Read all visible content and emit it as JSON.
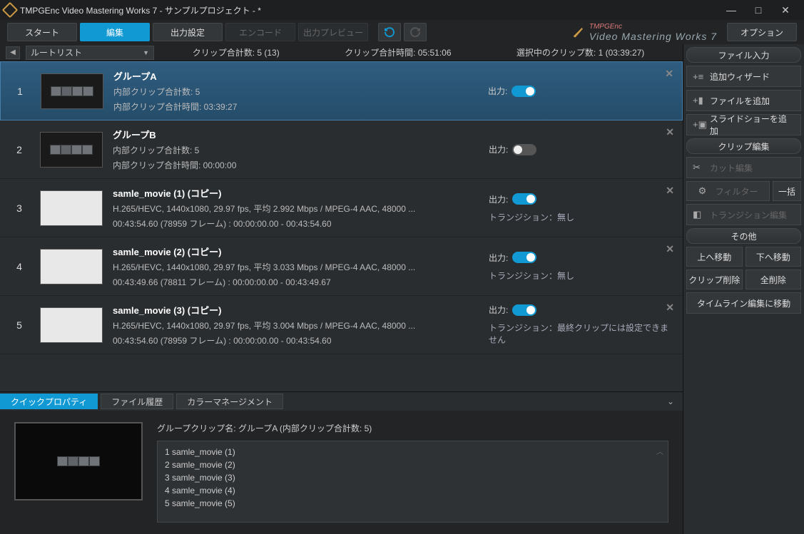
{
  "window": {
    "title": "TMPGEnc Video Mastering Works 7 - サンプルプロジェクト - *"
  },
  "toolbar": {
    "start": "スタート",
    "edit": "編集",
    "output": "出力設定",
    "encode": "エンコード",
    "preview": "出力プレビュー",
    "options": "オプション"
  },
  "brand": {
    "sub": "TMPGEnc",
    "name": "Video Mastering Works 7"
  },
  "stats": {
    "dropdown": "ルートリスト",
    "clip_count_label": "クリップ合計数:",
    "clip_count_value": "5 (13)",
    "total_time_label": "クリップ合計時間:",
    "total_time_value": "05:51:06",
    "selected_label": "選択中のクリップ数:",
    "selected_value": "1 (03:39:27)"
  },
  "clips": [
    {
      "num": "1",
      "is_group": true,
      "selected": true,
      "title": "グループA",
      "line1": "内部クリップ合計数: 5",
      "line2": "内部クリップ合計時間: 03:39:27",
      "output_label": "出力:",
      "output_on": true,
      "transition": ""
    },
    {
      "num": "2",
      "is_group": true,
      "selected": false,
      "title": "グループB",
      "line1": "内部クリップ合計数: 5",
      "line2": "内部クリップ合計時間: 00:00:00",
      "output_label": "出力:",
      "output_on": false,
      "transition": ""
    },
    {
      "num": "3",
      "is_group": false,
      "selected": false,
      "title": "samle_movie (1) (コピー)",
      "line1": "H.265/HEVC,  1440x1080,  29.97 fps,  平均 2.992 Mbps / MPEG-4 AAC,  48000 ...",
      "line2": "00:43:54.60 (78959 フレーム) :  00:00:00.00 - 00:43:54.60",
      "output_label": "出力:",
      "output_on": true,
      "transition": "トランジション：無し"
    },
    {
      "num": "4",
      "is_group": false,
      "selected": false,
      "title": "samle_movie (2) (コピー)",
      "line1": "H.265/HEVC,  1440x1080,  29.97 fps,  平均 3.033 Mbps / MPEG-4 AAC,  48000 ...",
      "line2": "00:43:49.66 (78811 フレーム) :  00:00:00.00 - 00:43:49.67",
      "output_label": "出力:",
      "output_on": true,
      "transition": "トランジション：無し"
    },
    {
      "num": "5",
      "is_group": false,
      "selected": false,
      "title": "samle_movie (3) (コピー)",
      "line1": "H.265/HEVC,  1440x1080,  29.97 fps,  平均 3.004 Mbps / MPEG-4 AAC,  48000 ...",
      "line2": "00:43:54.60 (78959 フレーム) :  00:00:00.00 - 00:43:54.60",
      "output_label": "出力:",
      "output_on": true,
      "transition": "トランジション：最終クリップには設定できません"
    }
  ],
  "bottom": {
    "tab_quick": "クイックプロパティ",
    "tab_history": "ファイル履歴",
    "tab_color": "カラーマネージメント",
    "group_label": "グループクリップ名: グループA (内部クリップ合計数: 5)",
    "items": [
      {
        "n": "1",
        "t": "samle_movie (1)"
      },
      {
        "n": "2",
        "t": "samle_movie (2)"
      },
      {
        "n": "3",
        "t": "samle_movie (3)"
      },
      {
        "n": "4",
        "t": "samle_movie (4)"
      },
      {
        "n": "5",
        "t": "samle_movie (5)"
      }
    ]
  },
  "side": {
    "file_input": "ファイル入力",
    "add_wizard": "追加ウィザード",
    "add_file": "ファイルを追加",
    "add_slideshow": "スライドショーを追加",
    "clip_edit": "クリップ編集",
    "cut_edit": "カット編集",
    "filter": "フィルター",
    "batch": "一括",
    "trans_edit": "トランジション編集",
    "other": "その他",
    "move_up": "上へ移動",
    "move_down": "下へ移動",
    "clip_del": "クリップ削除",
    "all_del": "全削除",
    "timeline": "タイムライン編集に移動"
  }
}
